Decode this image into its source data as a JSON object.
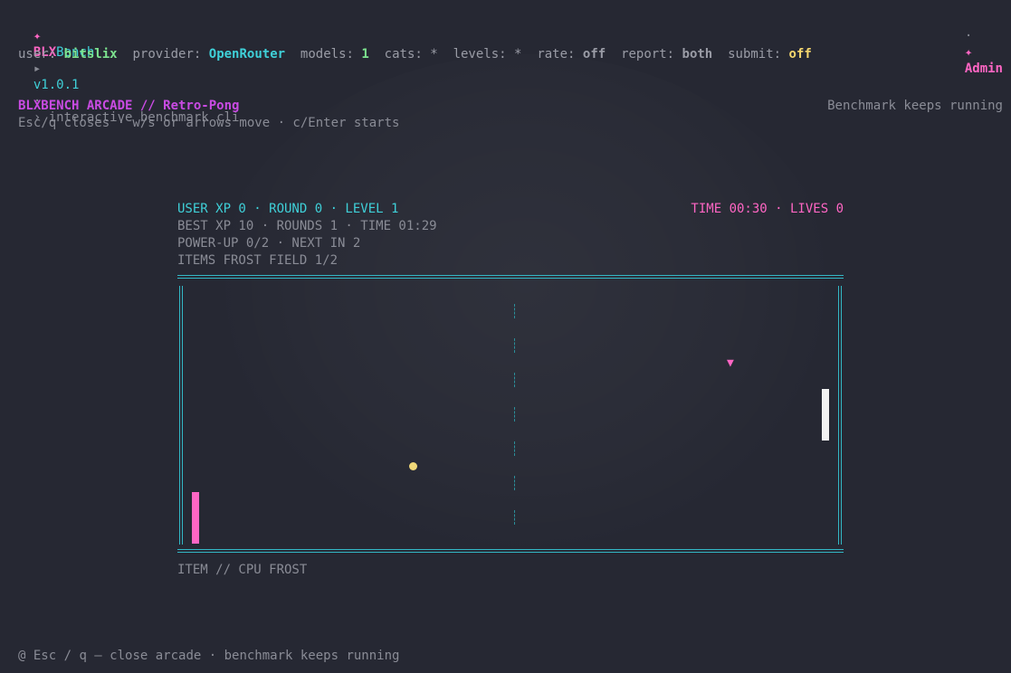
{
  "topbar": {
    "logo_star": "✦",
    "brand_a": "BLX",
    "brand_b": "Bench",
    "arrow": "▸",
    "version": "v1.0.1",
    "dot": "·",
    "subtitle": "› interactive benchmark cli",
    "admin_dot": "·",
    "admin_star": "✦",
    "admin_label": "Admin"
  },
  "status": {
    "user_label": "user:",
    "user_value": "bitslix",
    "provider_label": "provider:",
    "provider_value": "OpenRouter",
    "models_label": "models:",
    "models_value": "1",
    "cats_label": "cats:",
    "cats_value": "*",
    "levels_label": "levels:",
    "levels_value": "*",
    "rate_label": "rate:",
    "rate_value": "off",
    "report_label": "report:",
    "report_value": "both",
    "submit_label": "submit:",
    "submit_value": "off"
  },
  "arcade": {
    "title": "BLXBENCH ARCADE // Retro-Pong",
    "hint": "Esc/q closes · w/s or arrows move · c/Enter starts",
    "running": "Benchmark keeps running"
  },
  "hud": {
    "line1_left": "USER XP 0 · ROUND 0 · LEVEL 1",
    "line1_right": "TIME 00:30 · LIVES 0",
    "line2": "BEST XP 10 · ROUNDS 1 · TIME 01:29",
    "line3": "POWER-UP 0/2 · NEXT IN 2",
    "line4": "ITEMS FROST FIELD 1/2"
  },
  "game": {
    "powerup_glyph": "▼",
    "item_caption": "ITEM // CPU FROST"
  },
  "footer": {
    "icon": "@",
    "text": "Esc / q — close arcade · benchmark keeps running"
  },
  "colors": {
    "background": "#262833",
    "accent_pink": "#ff66c4",
    "accent_cyan": "#3fd0d8",
    "accent_magenta": "#c94be3",
    "accent_green": "#7de38f",
    "accent_yellow": "#f5d76e",
    "ball": "#f0d878",
    "cpu_paddle": "#f2f2f2"
  }
}
